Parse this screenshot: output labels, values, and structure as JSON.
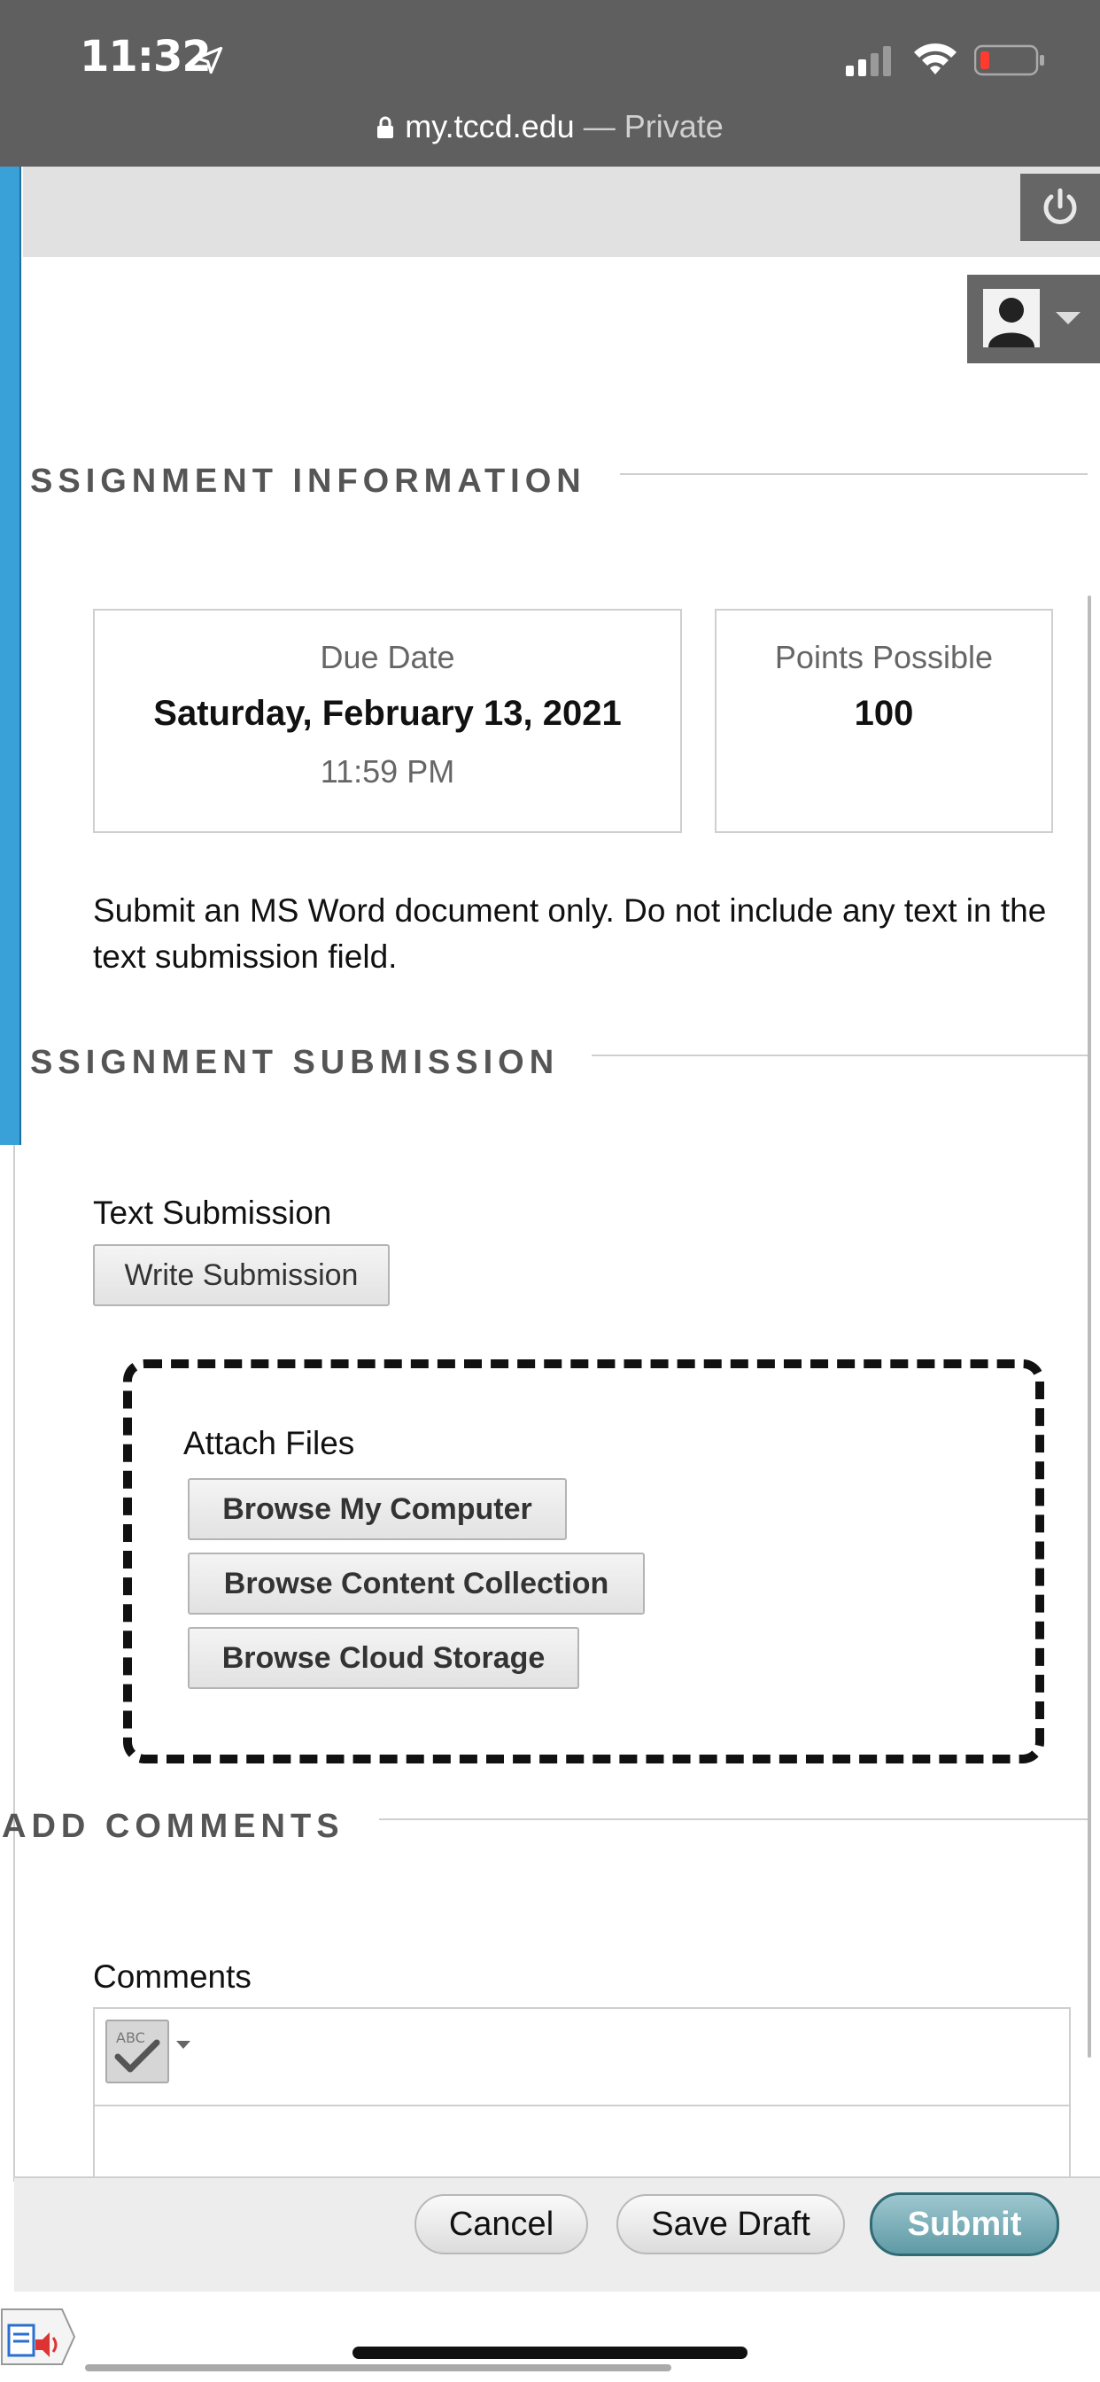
{
  "status_bar": {
    "time": "11:32",
    "url": "my.tccd.edu",
    "url_suffix": " — Private"
  },
  "sections": {
    "assignment_info": "SSIGNMENT INFORMATION",
    "assignment_submission": "SSIGNMENT SUBMISSION",
    "add_comments": "ADD COMMENTS"
  },
  "due_date": {
    "label": "Due Date",
    "date": "Saturday, February 13, 2021",
    "time": "11:59 PM"
  },
  "points": {
    "label": "Points Possible",
    "value": "100"
  },
  "instructions": "Submit an MS Word document only. Do not include any text in the text submission field.",
  "text_submission": {
    "label": "Text Submission",
    "button": "Write Submission"
  },
  "attach_files": {
    "label": "Attach Files",
    "buttons": [
      "Browse My Computer",
      "Browse Content Collection",
      "Browse Cloud Storage"
    ]
  },
  "comments": {
    "label": "Comments",
    "spellcheck_icon": "spellcheck-icon"
  },
  "actions": {
    "cancel": "Cancel",
    "save_draft": "Save Draft",
    "submit": "Submit"
  },
  "colors": {
    "status_bar": "#5f5f5f",
    "left_accent": "#3aa0d8",
    "submit_button": "#5f9aa5"
  }
}
